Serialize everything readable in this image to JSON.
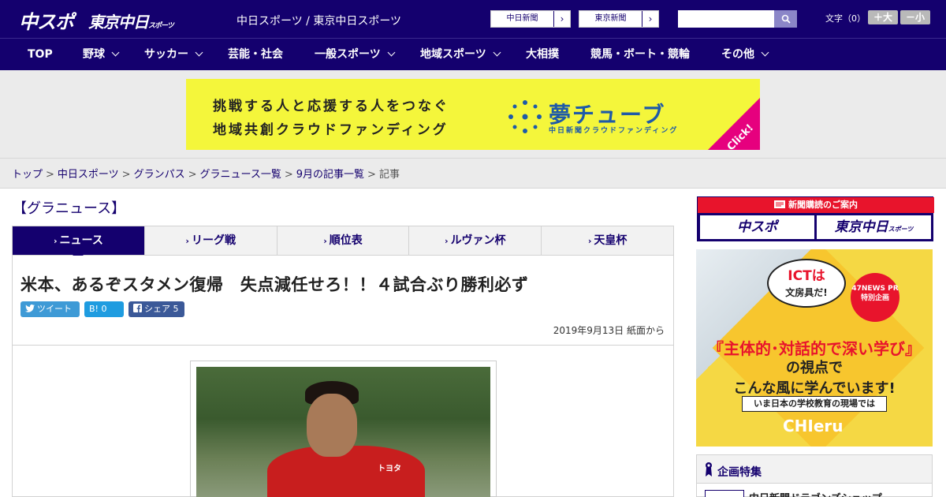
{
  "header": {
    "logo_chuspo": "中スポ",
    "logo_tokyo": "東京中日",
    "logo_tokyo_small": "スポーツ",
    "site_name": "中日スポーツ / 東京中日スポーツ",
    "paper_buttons": [
      "中日新聞",
      "東京新聞"
    ],
    "search_placeholder": "",
    "font_label": "文字（0）",
    "font_bigger": "＋大",
    "font_smaller": "－小"
  },
  "nav": {
    "items": [
      {
        "label": "TOP",
        "dropdown": false
      },
      {
        "label": "野球",
        "dropdown": true
      },
      {
        "label": "サッカー",
        "dropdown": true
      },
      {
        "label": "芸能・社会",
        "dropdown": false
      },
      {
        "label": "一般スポーツ",
        "dropdown": true
      },
      {
        "label": "地域スポーツ",
        "dropdown": true
      },
      {
        "label": "大相撲",
        "dropdown": false
      },
      {
        "label": "競馬・ボート・競輪",
        "dropdown": false
      },
      {
        "label": "その他",
        "dropdown": true
      }
    ]
  },
  "banner": {
    "line1": "挑戦する人と応援する人をつなぐ",
    "line2": "地域共創クラウドファンディング",
    "logo": "夢チューブ",
    "sub": "中日新聞クラウドファンディング",
    "click": "Click!"
  },
  "breadcrumb": {
    "items": [
      "トップ",
      "中日スポーツ",
      "グランパス",
      "グラニュース一覧",
      "9月の記事一覧"
    ],
    "current": "記事",
    "sep": ">"
  },
  "section": {
    "title": "【グラニュース】",
    "tabs": [
      {
        "label": "ニュース",
        "active": true
      },
      {
        "label": "リーグ戦",
        "active": false
      },
      {
        "label": "順位表",
        "active": false
      },
      {
        "label": "ルヴァン杯",
        "active": false
      },
      {
        "label": "天皇杯",
        "active": false
      }
    ]
  },
  "article": {
    "headline": "米本、あるぞスタメン復帰　失点減任せろ！！４試合ぶり勝利必ず",
    "share_tweet": "ツイート",
    "share_hatena": "B! 0",
    "share_facebook": "シェア 5",
    "pubdate": "2019年9月13日 紙面から",
    "photo_shirt_text": "トヨタ"
  },
  "sidebar": {
    "subscribe_title": "新聞購読のご案内",
    "subscribe_logo_1": "中スポ",
    "subscribe_logo_2": "東京中日",
    "subscribe_logo_2_small": "スポーツ",
    "ad": {
      "bubble_main": "ICTは",
      "bubble_sub": "文房具だ!",
      "pr": "47NEWS PR 特別企画",
      "big": "『主体的･対話的で深い学び』",
      "mid1": "の視点で",
      "mid2": "こんな風に学んでいます!",
      "ribbon": "いま日本の学校教育の現場では",
      "brand": "CHIeru"
    },
    "feature_title": "企画特集",
    "feature_item": "中日新聞ドラゴンズショップ"
  },
  "colors": {
    "brand_navy": "#14006e",
    "banner_yellow": "#f4f63b",
    "accent_red": "#e8142c"
  }
}
